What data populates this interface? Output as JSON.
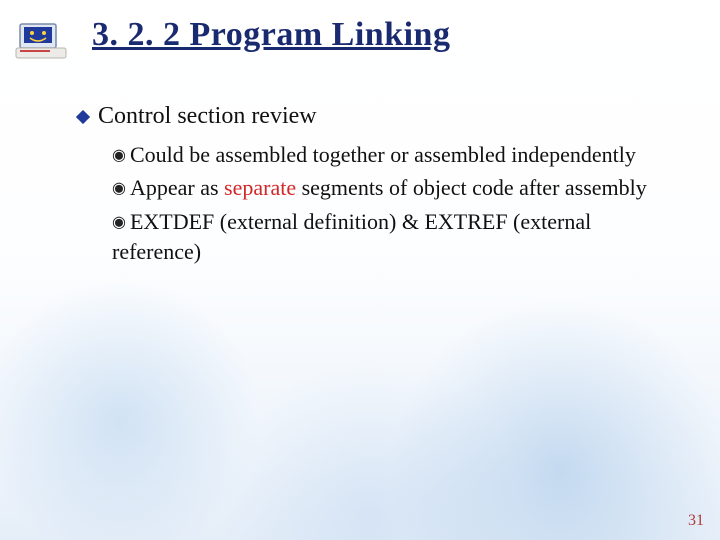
{
  "title": "3. 2. 2 Program Linking",
  "level1": {
    "text": "Control section review"
  },
  "level2": [
    {
      "text_a": "Could be assembled together or assembled independently"
    },
    {
      "text_a": "Appear as ",
      "highlight": "separate",
      "text_b": " segments of object code after assembly"
    },
    {
      "text_a": "EXTDEF (external definition) & EXTREF (external reference)"
    }
  ],
  "page_number": "31"
}
